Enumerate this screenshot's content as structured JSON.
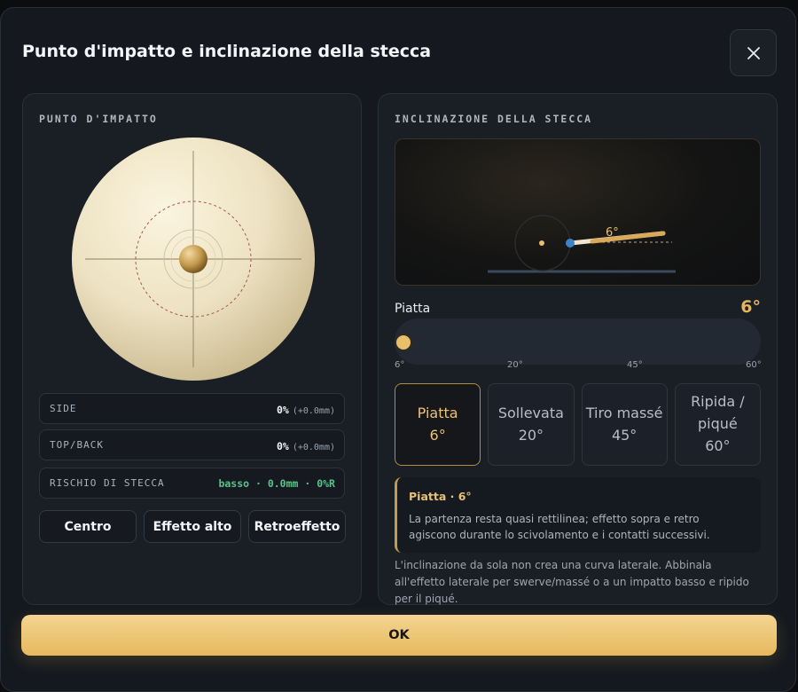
{
  "dialog": {
    "title": "Punto d'impatto e inclinazione della stecca",
    "close_icon": "close-icon",
    "ok_label": "OK"
  },
  "impact": {
    "label": "PUNTO D'IMPATTO",
    "side_label": "SIDE",
    "side_value": "0%",
    "side_sub": "(+0.0mm)",
    "topback_label": "TOP/BACK",
    "topback_value": "0%",
    "topback_sub": "(+0.0mm)",
    "risk_label": "RISCHIO DI STECCA",
    "risk_value": "basso · 0.0mm · 0%R",
    "buttons": [
      "Centro",
      "Effetto alto",
      "Retroeffetto"
    ]
  },
  "elevation": {
    "label": "INCLINAZIONE DELLA STECCA",
    "angle_tag": "6°",
    "slider_title": "Piatta",
    "slider_value": "6°",
    "slider_min": 6,
    "slider_max": 60,
    "slider_current": 6,
    "ticks": [
      "6°",
      "20°",
      "45°",
      "60°"
    ],
    "presets": [
      {
        "name": "Piatta",
        "angle": "6°"
      },
      {
        "name": "Sollevata",
        "angle": "20°"
      },
      {
        "name": "Tiro massé",
        "angle": "45°"
      },
      {
        "name": "Ripida / piqué",
        "angle": "60°"
      }
    ],
    "info_title": "Piatta · 6°",
    "info_text": "La partenza resta quasi rettilinea; effetto sopra e retro agiscono durante lo scivolamento e i contatti successivi.",
    "note": "L'inclinazione da sola non crea una curva laterale. Abbinala all'effetto laterale per swerve/massé o a un impatto basso e ripido per il piqué."
  },
  "colors": {
    "accent": "#e6b45c",
    "risk_green": "#59c38c"
  }
}
